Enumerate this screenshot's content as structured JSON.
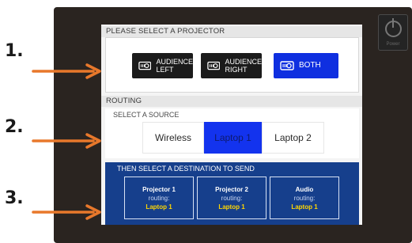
{
  "annotations": {
    "step1": "1.",
    "step2": "2.",
    "step3": "3."
  },
  "background": {
    "power_label": "Power"
  },
  "projector_section": {
    "header": "PLEASE SELECT A PROJECTOR",
    "buttons": [
      {
        "line1": "AUDIENCE",
        "line2": "LEFT",
        "icon": "projector-icon",
        "selected": false
      },
      {
        "line1": "AUDIENCE",
        "line2": "RIGHT",
        "icon": "projector-icon",
        "selected": false
      },
      {
        "line1": "BOTH",
        "line2": "",
        "icon": "projector-icon",
        "selected": true
      }
    ]
  },
  "routing": {
    "header": "ROUTING",
    "source_title": "SELECT A SOURCE",
    "sources": [
      {
        "label": "Wireless",
        "selected": false
      },
      {
        "label": "Laptop 1",
        "selected": true
      },
      {
        "label": "Laptop 2",
        "selected": false
      }
    ]
  },
  "destinations": {
    "title": "THEN SELECT A DESTINATION TO SEND",
    "cards": [
      {
        "name": "Projector 1",
        "routing_label": "routing:",
        "source": "Laptop 1"
      },
      {
        "name": "Projector 2",
        "routing_label": "routing:",
        "source": "Laptop 1"
      },
      {
        "name": "Audio",
        "routing_label": "routing:",
        "source": "Laptop 1"
      }
    ]
  },
  "colors": {
    "selected_blue": "#0f2fe0",
    "destination_panel": "#163f8c",
    "routing_source_yellow": "#ffd600",
    "annotation_arrow": "#e8782b"
  }
}
